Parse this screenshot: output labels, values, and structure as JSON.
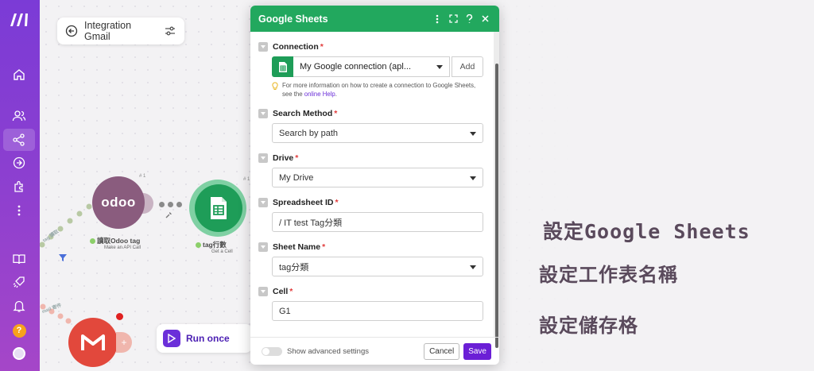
{
  "sidebar": {
    "items": [
      {
        "name": "home-icon"
      },
      {
        "name": "team-icon"
      },
      {
        "name": "scenarios-icon",
        "active": true
      },
      {
        "name": "templates-icon"
      },
      {
        "name": "apps-icon"
      },
      {
        "name": "more-icon"
      },
      {
        "name": "docs-icon"
      },
      {
        "name": "whats-new-icon"
      },
      {
        "name": "notifications-icon"
      }
    ],
    "help_label": "?"
  },
  "scenario": {
    "title": "Integration Gmail"
  },
  "nodes": {
    "odoo": {
      "logo": "odoo",
      "label": "讀取Odoo tag",
      "sub": "Make an API Call",
      "number": "# 1"
    },
    "sheets": {
      "label": "tag行數",
      "sub": "Get a Cell",
      "number": "# 1"
    },
    "left_labels": [
      "tag 讀取",
      "mail 寄件"
    ]
  },
  "run_panel": {
    "label": "Run once"
  },
  "modal": {
    "title": "Google Sheets",
    "fields": {
      "connection": {
        "label": "Connection",
        "value": "My Google connection (apl...",
        "add_label": "Add",
        "hint_text": "For more information on how to create a connection to Google Sheets, see the ",
        "hint_link": "online Help",
        "hint_end": "."
      },
      "search_method": {
        "label": "Search Method",
        "value": "Search by path"
      },
      "drive": {
        "label": "Drive",
        "value": "My Drive"
      },
      "spreadsheet_id": {
        "label": "Spreadsheet ID",
        "value": "/ IT test Tag分類"
      },
      "sheet_name": {
        "label": "Sheet Name",
        "value": "tag分類"
      },
      "cell": {
        "label": "Cell",
        "value": "G1"
      }
    },
    "footer": {
      "advanced_label": "Show advanced settings",
      "cancel_label": "Cancel",
      "save_label": "Save"
    }
  },
  "annotations": [
    "設定Google Sheets",
    "設定工作表名稱",
    "設定儲存格"
  ],
  "colors": {
    "brand_purple": "#6b2fd9",
    "sheets_green": "#22a85e",
    "required": "#e23b3b"
  }
}
